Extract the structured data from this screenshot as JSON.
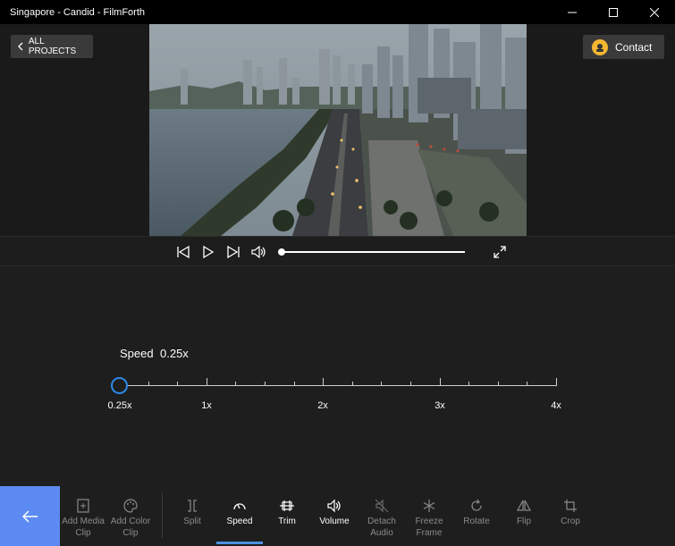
{
  "window": {
    "title": "Singapore - Candid - FilmForth"
  },
  "header": {
    "back_label": "ALL PROJECTS",
    "contact_label": "Contact"
  },
  "speed": {
    "label": "Speed",
    "value_label": "0.25x",
    "value": 0.25,
    "ticks": [
      "0.25x",
      "1x",
      "2x",
      "3x",
      "4x"
    ]
  },
  "toolbar": {
    "items": [
      {
        "label": "Add Media Clip",
        "icon": "add-media-icon"
      },
      {
        "label": "Add Color Clip",
        "icon": "palette-icon"
      },
      {
        "label": "Split",
        "icon": "split-icon"
      },
      {
        "label": "Speed",
        "icon": "speedometer-icon"
      },
      {
        "label": "Trim",
        "icon": "trim-icon"
      },
      {
        "label": "Volume",
        "icon": "volume-icon"
      },
      {
        "label": "Detach Audio",
        "icon": "detach-audio-icon"
      },
      {
        "label": "Freeze Frame",
        "icon": "snowflake-icon"
      },
      {
        "label": "Rotate",
        "icon": "rotate-icon"
      },
      {
        "label": "Flip",
        "icon": "flip-icon"
      },
      {
        "label": "Crop",
        "icon": "crop-icon"
      }
    ],
    "active": "Speed"
  },
  "colors": {
    "accent": "#5b8bf2",
    "knob": "#2d8ae8",
    "active_underline": "#4a90e2"
  }
}
